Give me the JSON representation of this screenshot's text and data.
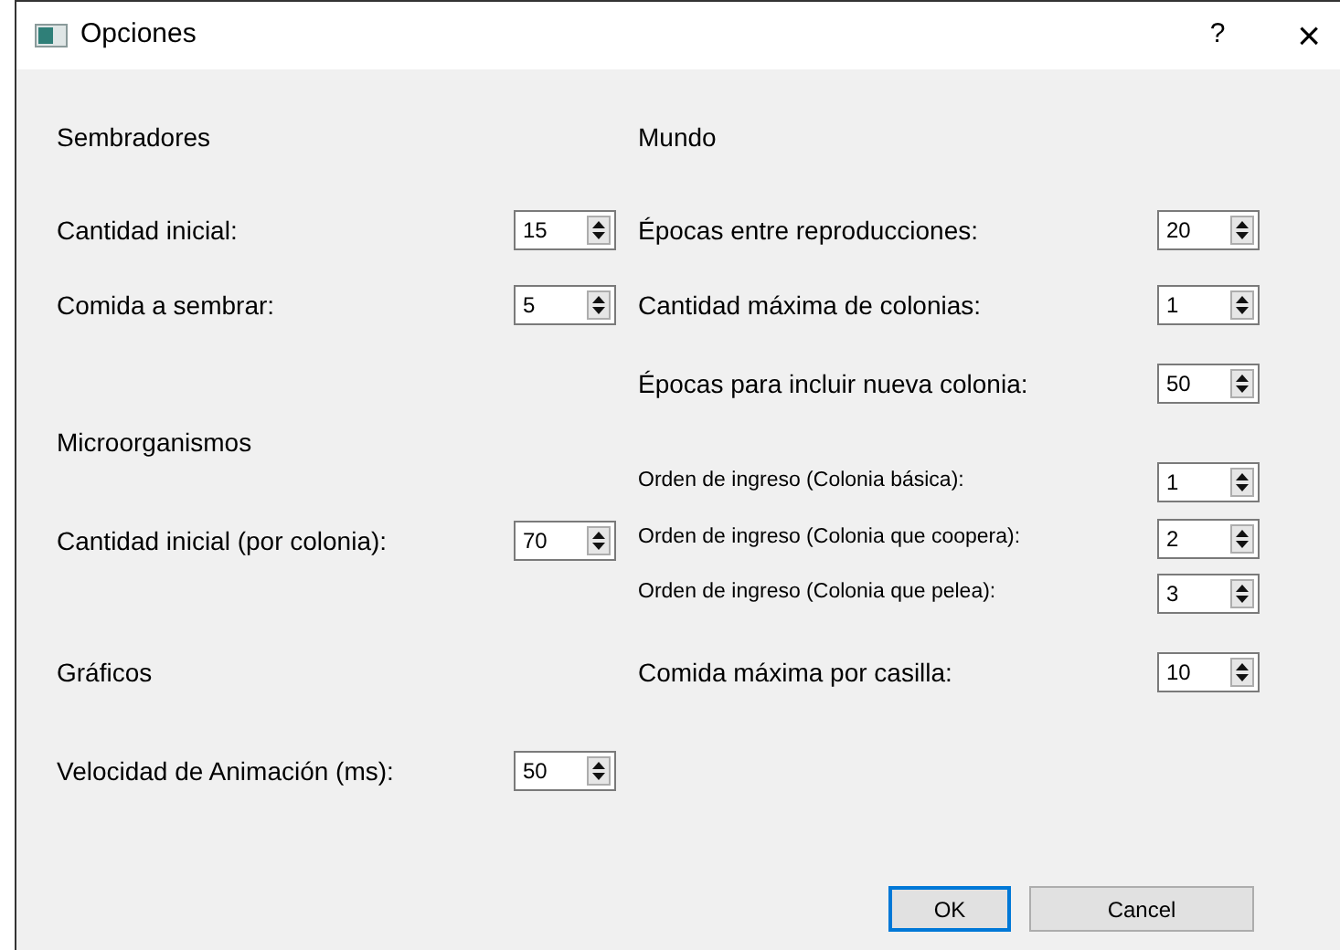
{
  "window": {
    "title": "Opciones",
    "help": "?",
    "close": "×"
  },
  "left_column": [
    {
      "kind": "heading",
      "label": "Sembradores"
    },
    {
      "kind": "spin",
      "label": "Cantidad inicial:",
      "value": "15"
    },
    {
      "kind": "spin",
      "label": "Comida a sembrar:",
      "value": "5"
    },
    {
      "kind": "heading",
      "label": "Microorganismos"
    },
    {
      "kind": "spin",
      "label": "Cantidad inicial (por colonia):",
      "value": "70"
    },
    {
      "kind": "heading",
      "label": "Gráficos"
    },
    {
      "kind": "spin",
      "label": "Velocidad de Animación (ms):",
      "value": "50"
    }
  ],
  "right_column": [
    {
      "kind": "heading",
      "label": "Mundo"
    },
    {
      "kind": "spin",
      "label": "Épocas entre reproducciones:",
      "value": "20"
    },
    {
      "kind": "spin",
      "label": "Cantidad máxima de colonias:",
      "value": "1"
    },
    {
      "kind": "spin",
      "label": "Épocas para incluir nueva colonia:",
      "value": "50"
    },
    {
      "kind": "small-spin",
      "label": "Orden de ingreso (Colonia básica):",
      "value": "1"
    },
    {
      "kind": "small-spin",
      "label": "Orden de ingreso (Colonia que coopera):",
      "value": "2"
    },
    {
      "kind": "small-spin",
      "label": "Orden de ingreso (Colonia que pelea):",
      "value": "3"
    },
    {
      "kind": "spin",
      "label": "Comida máxima por casilla:",
      "value": "10"
    }
  ],
  "buttons": [
    {
      "label": "OK",
      "default": true
    },
    {
      "label": "Cancel",
      "default": false
    }
  ]
}
